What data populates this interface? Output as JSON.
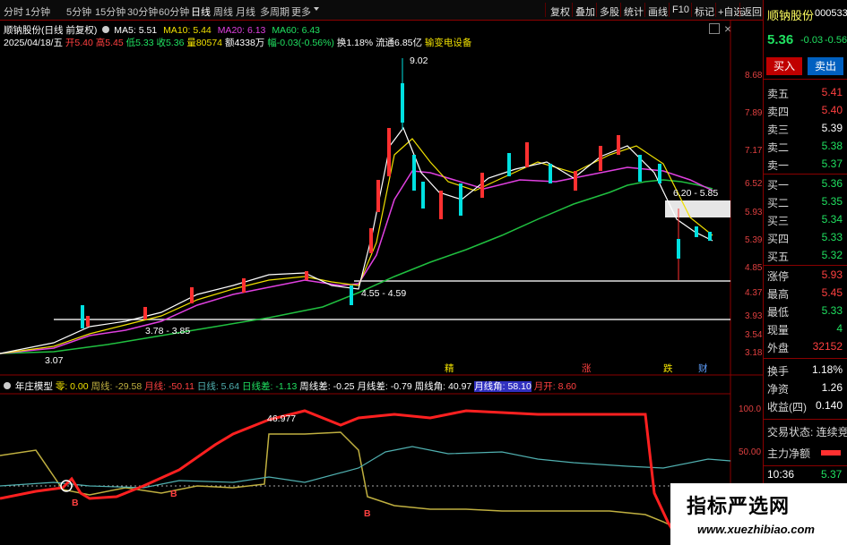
{
  "toolbar": {
    "periods": [
      "分时",
      "1分钟",
      "5分钟",
      "15分钟",
      "30分钟",
      "60分钟",
      "日线",
      "周线",
      "月线",
      "多周期",
      "更多"
    ],
    "active_period": "日线",
    "buttons": [
      "复权",
      "叠加",
      "多股",
      "统计",
      "画线",
      "F10",
      "标记",
      "+自选",
      "返回"
    ]
  },
  "stock": {
    "name": "顺钠股份",
    "code": "000533",
    "price": "5.36",
    "change": "-0.03",
    "change_pct": "-0.56%",
    "buy_label": "买入",
    "sell_label": "卖出"
  },
  "chart_header": {
    "title": "顺钠股份(日线 前复权)",
    "ma5": "MA5: 5.51",
    "ma10": "MA10: 5.44",
    "ma20": "MA20: 6.13",
    "ma60": "MA60: 6.43",
    "date": "2025/04/18/五",
    "open": "开5.40",
    "high": "高5.45",
    "low": "低5.33",
    "close": "收5.36",
    "volume": "量80574",
    "amount": "额4338万",
    "range": "幅-0.03(-0.56%)",
    "turnover": "换1.18%",
    "float": "流通6.85亿",
    "sector": "输变电设备"
  },
  "price_axis": [
    "8.68",
    "7.89",
    "7.17",
    "6.52",
    "5.93",
    "5.39",
    "4.85",
    "4.37",
    "3.93",
    "3.54",
    "3.18"
  ],
  "annotations": {
    "peak": "9.02",
    "low_start": "3.07",
    "range1": "3.78 - 3.85",
    "range2": "4.55 - 4.59",
    "range3": "6.20 - 5.85",
    "mark_jing": "精",
    "mark_zhang": "涨",
    "mark_die": "跌",
    "mark_cai": "财"
  },
  "indicator_header": {
    "name": "年庄模型",
    "zero": "零: 0.00",
    "zhouxian": "周线: -29.58",
    "yuexian": "月线: -50.11",
    "rixian": "日线: 5.64",
    "rixiancha": "日线差: -1.13",
    "zhouxiancha": "周线差: -0.25",
    "yuexiancha": "月线差: -0.79",
    "zhouxianjiao": "周线角: 40.97",
    "yuexianjiao": "月线角: 58.10",
    "yuekai": "月开: 8.60"
  },
  "indicator_axis": [
    "100.0",
    "50.00"
  ],
  "indicator_annotations": {
    "peak_value": "46.977",
    "b_label": "B"
  },
  "order_book": {
    "sell": [
      {
        "label": "卖五",
        "price": "5.41"
      },
      {
        "label": "卖四",
        "price": "5.40"
      },
      {
        "label": "卖三",
        "price": "5.39"
      },
      {
        "label": "卖二",
        "price": "5.38"
      },
      {
        "label": "卖一",
        "price": "5.37"
      }
    ],
    "buy": [
      {
        "label": "买一",
        "price": "5.36"
      },
      {
        "label": "买二",
        "price": "5.35"
      },
      {
        "label": "买三",
        "price": "5.34"
      },
      {
        "label": "买四",
        "price": "5.33"
      },
      {
        "label": "买五",
        "price": "5.32"
      }
    ]
  },
  "stats": [
    {
      "label": "涨停",
      "value": "5.93"
    },
    {
      "label": "最高",
      "value": "5.45"
    },
    {
      "label": "最低",
      "value": "5.33"
    },
    {
      "label": "现量",
      "value": "4"
    },
    {
      "label": "外盘",
      "value": "32152"
    },
    {
      "label": "换手",
      "value": "1.18%"
    },
    {
      "label": "净资",
      "value": "1.26"
    },
    {
      "label": "收益(四)",
      "value": "0.140"
    }
  ],
  "trade_status": "交易状态: 连续竞",
  "net_flow_label": "主力净额",
  "last_tick": {
    "time": "10:36",
    "price": "5.37"
  },
  "watermark": {
    "cn": "指标严选网",
    "url": "www.xuezhibiao.com"
  }
}
